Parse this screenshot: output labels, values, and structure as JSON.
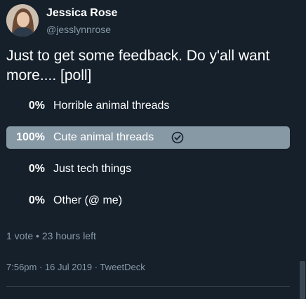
{
  "tweet": {
    "author_name": "Jessica Rose",
    "author_handle": "@jesslynnrose",
    "text": "Just to get some feedback. Do y'all want more.... [poll]",
    "poll": {
      "options": [
        {
          "percent": "0%",
          "label": "Horrible animal threads",
          "value": 0,
          "winner": false
        },
        {
          "percent": "100%",
          "label": "Cute animal threads",
          "value": 100,
          "winner": true
        },
        {
          "percent": "0%",
          "label": "Just tech things",
          "value": 0,
          "winner": false
        },
        {
          "percent": "0%",
          "label": "Other (@ me)",
          "value": 0,
          "winner": false
        }
      ],
      "meta": "1 vote • 23 hours left",
      "winner_icon": "check-circle-icon"
    },
    "timestamp": "7:56pm · 16 Jul 2019 · TweetDeck"
  },
  "colors": {
    "background": "#15202b",
    "text_primary": "#ffffff",
    "text_secondary": "#8899a6",
    "winner_fill": "#8899a6",
    "divider": "#38444d"
  }
}
